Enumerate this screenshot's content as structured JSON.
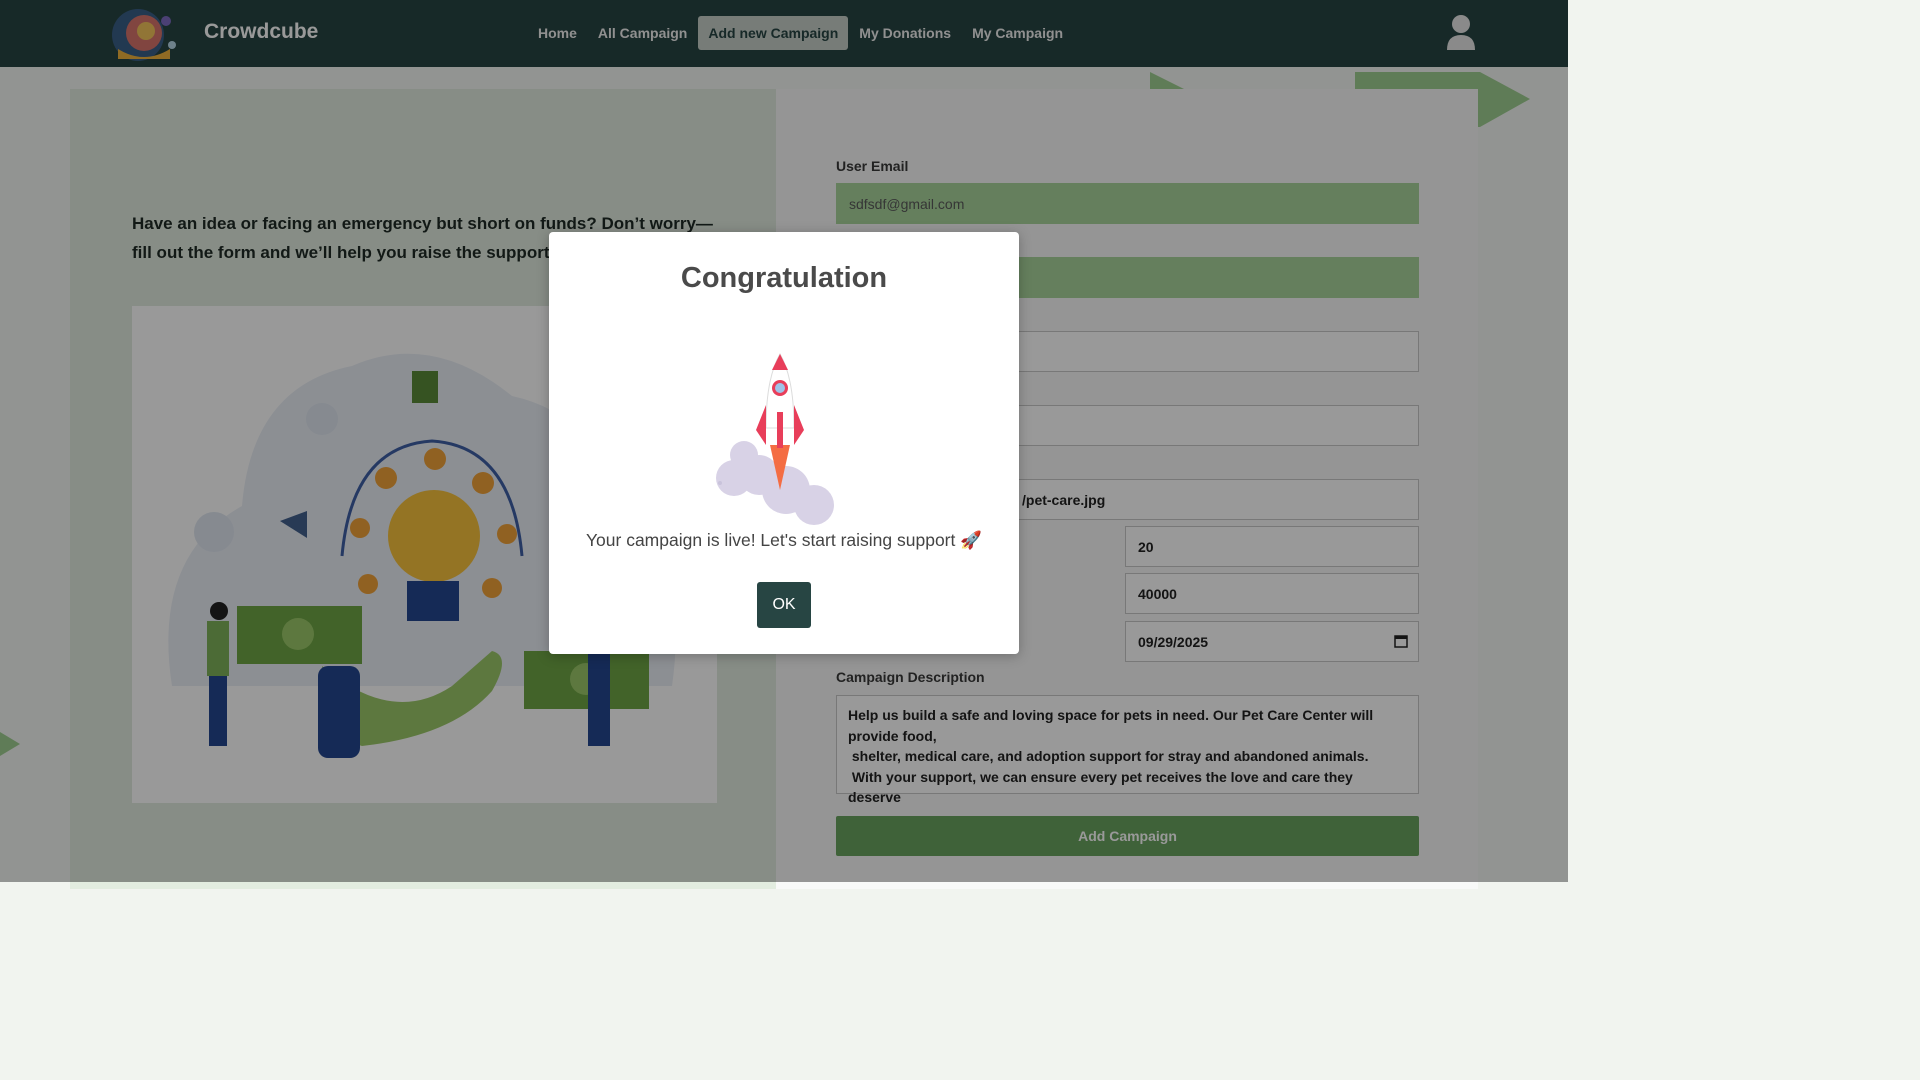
{
  "navbar": {
    "brand": "Crowdcube",
    "links": [
      "Home",
      "All Campaign",
      "Add new Campaign",
      "My Donations",
      "My Campaign"
    ],
    "active_link": "Add new Campaign",
    "user_icon": "user-icon"
  },
  "intro": {
    "text": "Have an idea or facing an emergency but short on funds? Don’t worry—fill out the form and we’ll help you raise the support you"
  },
  "form": {
    "user_email_label": "User Email",
    "user_email_value": "sdfsdf@gmail.com",
    "image_url_fragment": "/pet-care.jpg",
    "min_donation": "20",
    "goal_amount": "40000",
    "deadline": "09/29/2025",
    "description_label": "Campaign Description",
    "description_value": "Help us build a safe and loving space for pets in need. Our Pet Care Center will provide food,\n shelter, medical care, and adoption support for stray and abandoned animals.\n With your support, we can ensure every pet receives the love and care they deserve",
    "submit_label": "Add Campaign"
  },
  "modal": {
    "title": "Congratulation",
    "message": "Your campaign is live! Let's start raising support 🚀",
    "ok_label": "OK",
    "icon": "rocket-icon"
  },
  "colors": {
    "navbar_bg": "#274543",
    "accent_green": "#6aa45f",
    "input_green": "#a8d49c",
    "ok_button": "#274543"
  }
}
